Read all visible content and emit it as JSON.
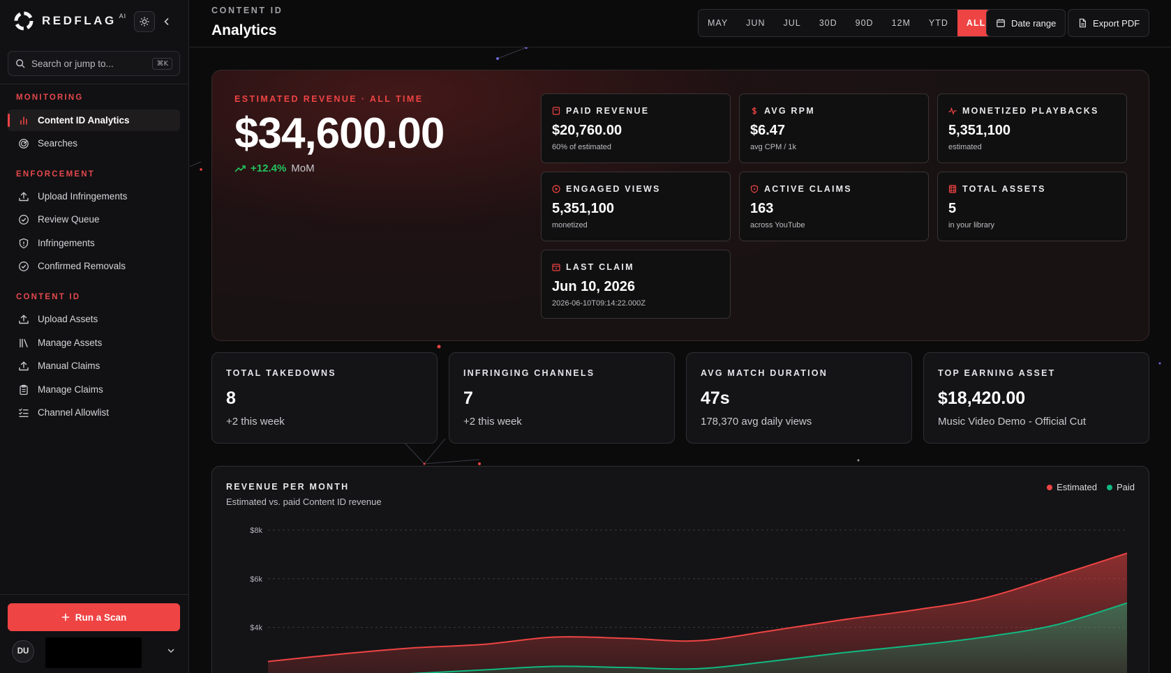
{
  "app": {
    "brand_name": "REDFLAG",
    "brand_sup": "AI"
  },
  "sidebar": {
    "search_placeholder": "Search or jump to...",
    "search_shortcut": "⌘K",
    "sections": [
      {
        "title": "MONITORING",
        "items": [
          {
            "label": "Content ID Analytics",
            "icon": "bar-chart-icon",
            "active": true
          },
          {
            "label": "Searches",
            "icon": "radar-icon"
          }
        ]
      },
      {
        "title": "ENFORCEMENT",
        "items": [
          {
            "label": "Upload Infringements",
            "icon": "upload-icon"
          },
          {
            "label": "Review Queue",
            "icon": "check-circle-icon"
          },
          {
            "label": "Infringements",
            "icon": "shield-icon"
          },
          {
            "label": "Confirmed Removals",
            "icon": "check-circle-icon"
          }
        ]
      },
      {
        "title": "CONTENT ID",
        "items": [
          {
            "label": "Upload Assets",
            "icon": "upload-icon"
          },
          {
            "label": "Manage Assets",
            "icon": "library-icon"
          },
          {
            "label": "Manual Claims",
            "icon": "upload-icon"
          },
          {
            "label": "Manage Claims",
            "icon": "clipboard-icon"
          },
          {
            "label": "Channel Allowlist",
            "icon": "list-check-icon"
          }
        ]
      }
    ],
    "scan_button": "Run a Scan",
    "avatar_initials": "DU"
  },
  "header": {
    "eyebrow": "CONTENT ID",
    "title": "Analytics",
    "ranges": [
      "MAY",
      "JUN",
      "JUL",
      "30D",
      "90D",
      "12M",
      "YTD",
      "ALL"
    ],
    "active_range": "ALL",
    "date_range_label": "Date range",
    "export_label": "Export PDF"
  },
  "hero": {
    "label": "ESTIMATED REVENUE · ALL TIME",
    "value": "$34,600.00",
    "trend": "+12.4%",
    "trend_unit": "MoM",
    "stats": [
      {
        "label": "PAID REVENUE",
        "value": "$20,760.00",
        "sub": "60% of estimated",
        "icon": "receipt-icon"
      },
      {
        "label": "AVG RPM",
        "value": "$6.47",
        "sub": "avg CPM / 1k",
        "icon": "dollar-icon"
      },
      {
        "label": "MONETIZED PLAYBACKS",
        "value": "5,351,100",
        "sub": "estimated",
        "icon": "pulse-icon"
      },
      {
        "label": "ENGAGED VIEWS",
        "value": "5,351,100",
        "sub": "monetized",
        "icon": "play-circle-icon"
      },
      {
        "label": "ACTIVE CLAIMS",
        "value": "163",
        "sub": "across YouTube",
        "icon": "shield-icon"
      },
      {
        "label": "TOTAL ASSETS",
        "value": "5",
        "sub": "in your library",
        "icon": "film-icon"
      },
      {
        "label": "LAST CLAIM",
        "value": "Jun 10, 2026",
        "sub": "2026-06-10T09:14:22.000Z",
        "icon": "calendar-icon"
      }
    ]
  },
  "cards": [
    {
      "label": "TOTAL TAKEDOWNS",
      "value": "8",
      "sub": "+2 this week"
    },
    {
      "label": "INFRINGING CHANNELS",
      "value": "7",
      "sub": "+2 this week"
    },
    {
      "label": "AVG MATCH DURATION",
      "value": "47s",
      "sub": "178,370 avg daily views"
    },
    {
      "label": "TOP EARNING ASSET",
      "value": "$18,420.00",
      "sub": "Music Video Demo - Official Cut"
    }
  ],
  "colors": {
    "accent": "#ef4444",
    "positive": "#22c55e",
    "estimated": "#ef4444",
    "paid": "#10b981"
  },
  "chart_data": {
    "type": "area",
    "title": "REVENUE PER MONTH",
    "subtitle": "Estimated vs. paid Content ID revenue",
    "y_ticks": [
      "$8k",
      "$6k",
      "$4k"
    ],
    "y_tick_values": [
      8000,
      6000,
      4000
    ],
    "ylim": [
      0,
      8000
    ],
    "legend_position": "top-right",
    "grid": true,
    "series": [
      {
        "name": "Estimated",
        "color": "#ef4444",
        "values": [
          2600,
          2900,
          3150,
          3300,
          3600,
          3550,
          3450,
          3850,
          4300,
          4700,
          5200,
          6100,
          7050
        ]
      },
      {
        "name": "Paid",
        "color": "#10b981",
        "values": [
          1700,
          1950,
          2100,
          2250,
          2400,
          2350,
          2300,
          2600,
          2950,
          3250,
          3600,
          4100,
          5000
        ]
      }
    ]
  }
}
